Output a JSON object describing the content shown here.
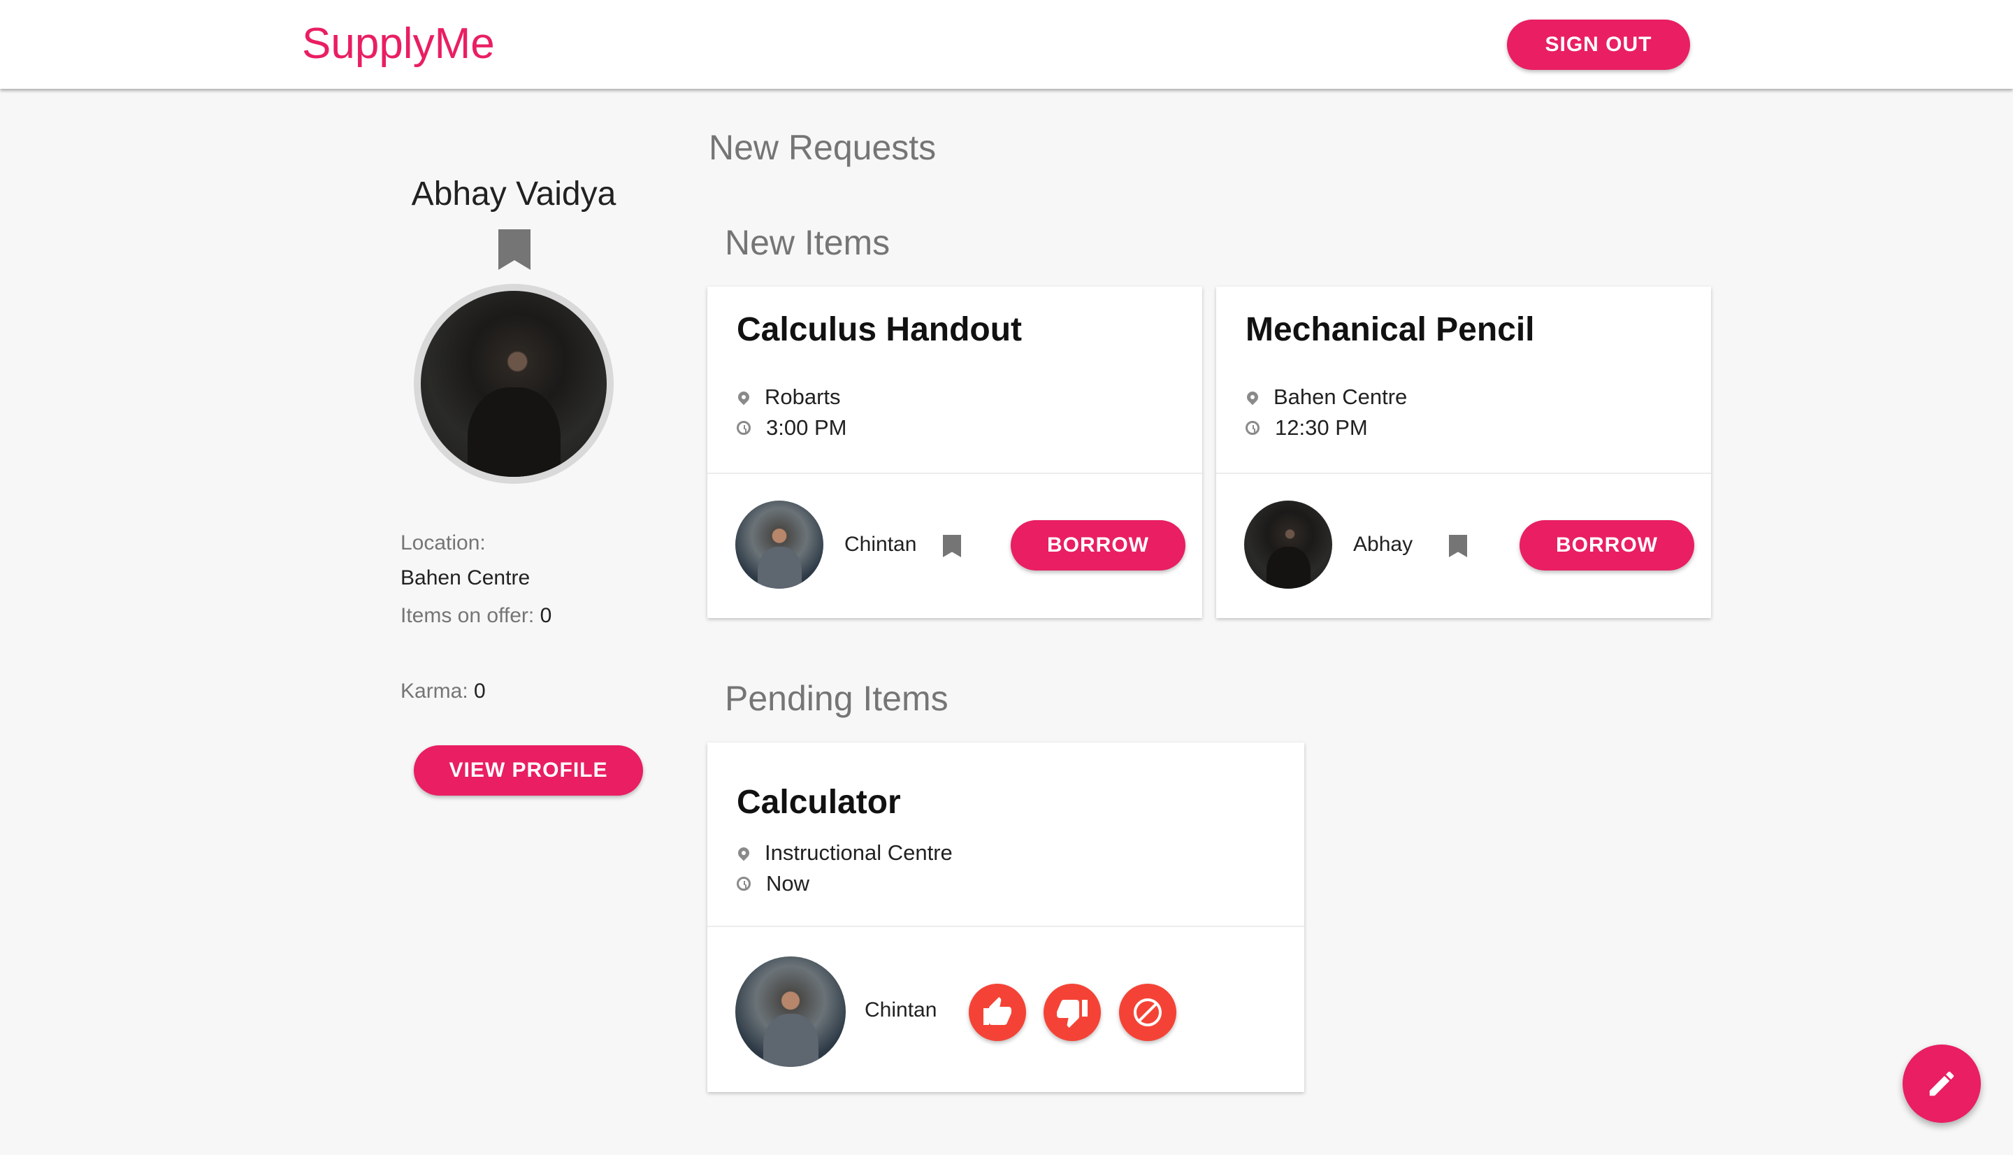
{
  "app": {
    "brand": "SupplyMe",
    "sign_out_label": "SIGN OUT"
  },
  "profile": {
    "name": "Abhay Vaidya",
    "location_label": "Location:",
    "location_value": "Bahen Centre",
    "items_on_offer_label": "Items on offer:",
    "items_on_offer_value": "0",
    "karma_label": "Karma:",
    "karma_value": "0",
    "view_profile_label": "VIEW PROFILE"
  },
  "main": {
    "new_requests_heading": "New Requests",
    "new_items_heading": "New Items",
    "pending_items_heading": "Pending Items",
    "new_items": [
      {
        "title": "Calculus Handout",
        "location": "Robarts",
        "time": "3:00 PM",
        "owner": "Chintan",
        "action": "BORROW"
      },
      {
        "title": "Mechanical Pencil",
        "location": "Bahen Centre",
        "time": "12:30 PM",
        "owner": "Abhay",
        "action": "BORROW"
      }
    ],
    "pending_items": [
      {
        "title": "Calculator",
        "location": "Instructional Centre",
        "time": "Now",
        "owner": "Chintan"
      }
    ]
  },
  "icons": {
    "profile_bookmark": "bookmark-icon",
    "location": "map-pin-icon",
    "time": "clock-icon",
    "approve": "thumbs-up-icon",
    "reject": "thumbs-down-icon",
    "cancel": "block-icon",
    "fab": "pencil-icon"
  },
  "colors": {
    "accent": "#e91e63",
    "action_red": "#f44336",
    "muted": "#757575"
  }
}
